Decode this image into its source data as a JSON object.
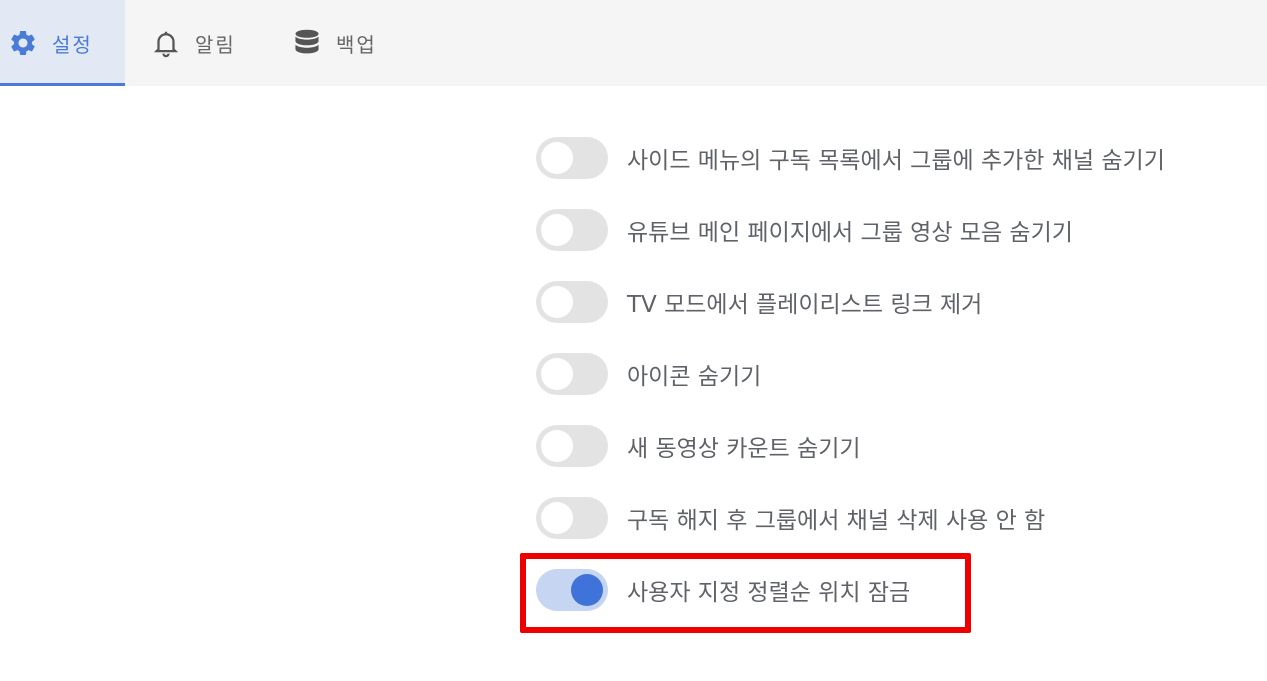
{
  "tabs": [
    {
      "label": "설정",
      "icon": "gear-icon"
    },
    {
      "label": "알림",
      "icon": "bell-icon"
    },
    {
      "label": "백업",
      "icon": "database-icon"
    }
  ],
  "active_tab": "설정",
  "options": [
    {
      "label": "사이드 메뉴의 구독 목록에서 그룹에 추가한 채널 숨기기",
      "enabled": false
    },
    {
      "label": "유튜브 메인 페이지에서 그룹 영상 모음 숨기기",
      "enabled": false
    },
    {
      "label": "TV 모드에서 플레이리스트 링크 제거",
      "enabled": false
    },
    {
      "label": "아이콘 숨기기",
      "enabled": false
    },
    {
      "label": "새 동영상 카운트 숨기기",
      "enabled": false
    },
    {
      "label": "구독 해지 후 그룹에서 채널 삭제 사용 안 함",
      "enabled": false
    },
    {
      "label": "사용자 지정 정렬순 위치 잠금",
      "enabled": true
    }
  ],
  "colors": {
    "accent": "#3f73d9",
    "highlight_border": "#ee0000"
  }
}
